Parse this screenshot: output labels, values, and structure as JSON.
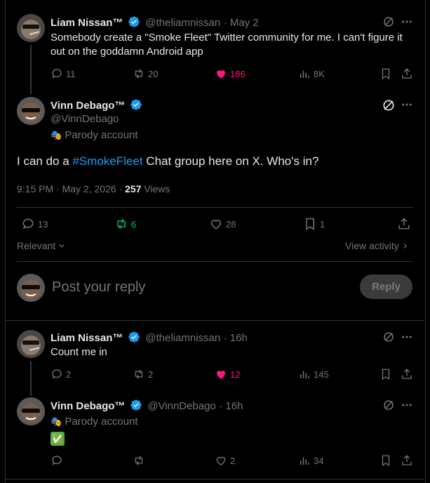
{
  "post1": {
    "name": "Liam Nissan™",
    "handle": "@theliamnissan",
    "time": "· May 2",
    "text_line1": "Somebody create a \"Smoke Fleet\" Twitter community for me. I can't figure it",
    "text_line2": "out on the goddamn Android app",
    "replies": "11",
    "reposts": "20",
    "likes": "186",
    "views": "8K"
  },
  "main": {
    "name": "Vinn Debago™",
    "handle": "@VinnDebago",
    "parody_label": "Parody account",
    "text_pre": "I can do a ",
    "hashtag": "#SmokeFleet",
    "text_post": " Chat group here on X. Who's in?",
    "timestamp": "9:15 PM · May 2, 2026 · ",
    "views_count": "257",
    "views_label": " Views",
    "replies": "13",
    "reposts": "6",
    "likes": "28",
    "bookmarks": "1",
    "relevant_label": "Relevant",
    "view_activity_label": "View activity"
  },
  "composer": {
    "placeholder": "Post your reply",
    "reply_button": "Reply"
  },
  "reply1": {
    "name": "Liam Nissan™",
    "handle": "@theliamnissan",
    "time": "· 16h",
    "text": "Count me in",
    "replies": "2",
    "reposts": "2",
    "likes": "12",
    "views": "145"
  },
  "reply2": {
    "name": "Vinn Debago™",
    "handle": "@VinnDebago",
    "time": "· 16h",
    "parody_label": "Parody account",
    "text": "✅",
    "likes": "2",
    "views": "34"
  },
  "colors": {
    "background": "#000000",
    "accent": "#1d9bf0",
    "like": "#f91880",
    "repost": "#00ba7c",
    "muted": "#71767b"
  }
}
